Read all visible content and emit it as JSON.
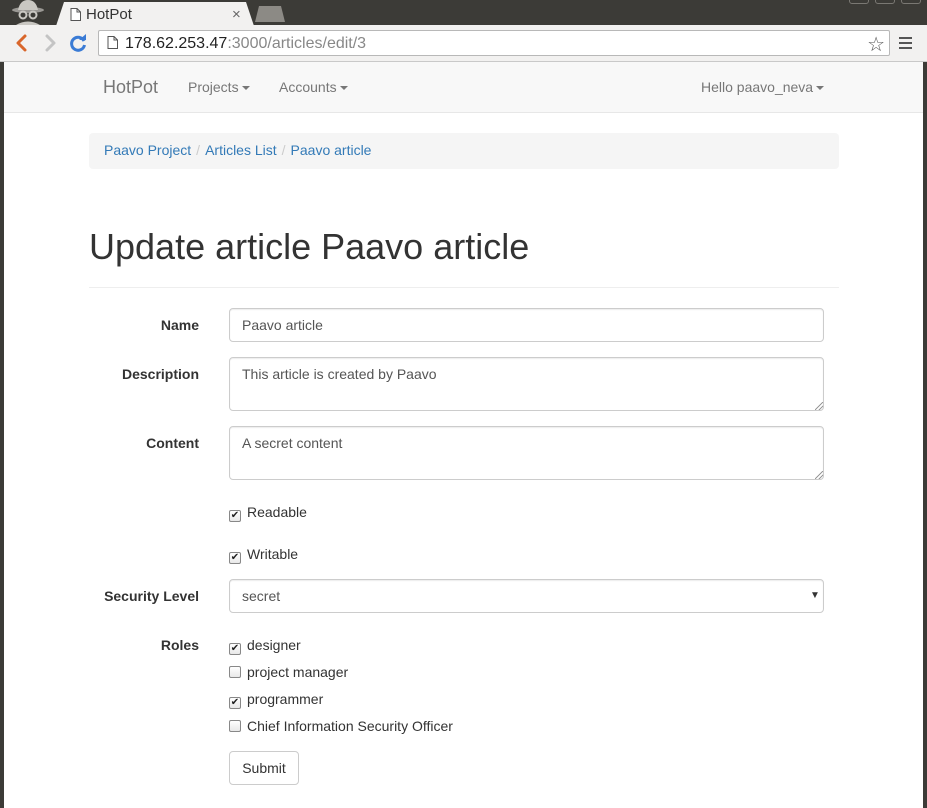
{
  "browser": {
    "tab_title": "HotPot",
    "tab_close": "×",
    "url_host": "178.62.253.47",
    "url_path": ":3000/articles/edit/3"
  },
  "navbar": {
    "brand": "HotPot",
    "projects": "Projects",
    "accounts": "Accounts",
    "user": "Hello paavo_neva"
  },
  "breadcrumb": {
    "project": "Paavo Project",
    "list": "Articles List",
    "current": "Paavo article",
    "separator": "/"
  },
  "page": {
    "title": "Update article Paavo article"
  },
  "form": {
    "name_label": "Name",
    "name_value": "Paavo article",
    "description_label": "Description",
    "description_value": "This article is created by Paavo",
    "content_label": "Content",
    "content_value": "A secret content",
    "readable_label": "Readable",
    "readable_checked": true,
    "writable_label": "Writable",
    "writable_checked": true,
    "security_label": "Security Level",
    "security_value": "secret",
    "roles_label": "Roles",
    "roles": [
      {
        "label": "designer",
        "checked": true
      },
      {
        "label": "project manager",
        "checked": false
      },
      {
        "label": "programmer",
        "checked": true
      },
      {
        "label": "Chief Information Security Officer",
        "checked": false
      }
    ],
    "submit": "Submit"
  }
}
